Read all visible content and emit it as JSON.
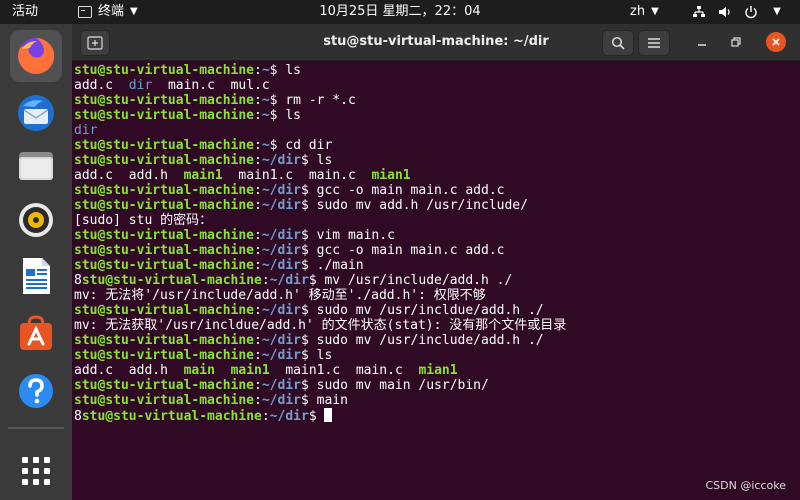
{
  "topbar": {
    "activities": "活动",
    "app_name": "终端",
    "clock": "10月25日 星期二，22：04",
    "lang": "zh"
  },
  "dock": {
    "items": [
      {
        "name": "firefox"
      },
      {
        "name": "thunderbird"
      },
      {
        "name": "files"
      },
      {
        "name": "rhythmbox"
      },
      {
        "name": "writer"
      },
      {
        "name": "software"
      },
      {
        "name": "help"
      },
      {
        "name": "show-apps"
      }
    ]
  },
  "window": {
    "title": "stu@stu-virtual-machine: ~/dir"
  },
  "terminal": {
    "user": "stu@stu-virtual-machine",
    "lines": [
      {
        "type": "prompt",
        "pre": "",
        "path": "~",
        "cmd": "ls"
      },
      {
        "type": "ls",
        "items": [
          {
            "t": "add.c",
            "c": "plain"
          },
          {
            "t": "dir",
            "c": "dir"
          },
          {
            "t": "main.c",
            "c": "plain"
          },
          {
            "t": "mul.c",
            "c": "plain"
          }
        ]
      },
      {
        "type": "prompt",
        "pre": "",
        "path": "~",
        "cmd": "rm -r *.c"
      },
      {
        "type": "prompt",
        "pre": "",
        "path": "~",
        "cmd": "ls"
      },
      {
        "type": "ls",
        "items": [
          {
            "t": "dir",
            "c": "dir"
          }
        ]
      },
      {
        "type": "prompt",
        "pre": "",
        "path": "~",
        "cmd": "cd dir"
      },
      {
        "type": "prompt",
        "pre": "",
        "path": "~/dir",
        "cmd": "ls"
      },
      {
        "type": "ls",
        "items": [
          {
            "t": "add.c",
            "c": "plain"
          },
          {
            "t": "add.h",
            "c": "plain"
          },
          {
            "t": "main1",
            "c": "exe"
          },
          {
            "t": "main1.c",
            "c": "plain"
          },
          {
            "t": "main.c",
            "c": "plain"
          },
          {
            "t": "mian1",
            "c": "exe"
          }
        ]
      },
      {
        "type": "prompt",
        "pre": "",
        "path": "~/dir",
        "cmd": "gcc -o main main.c add.c"
      },
      {
        "type": "prompt",
        "pre": "",
        "path": "~/dir",
        "cmd": "sudo mv add.h /usr/include/"
      },
      {
        "type": "text",
        "text": "[sudo] stu 的密码："
      },
      {
        "type": "prompt",
        "pre": "",
        "path": "~/dir",
        "cmd": "vim main.c"
      },
      {
        "type": "prompt",
        "pre": "",
        "path": "~/dir",
        "cmd": "gcc -o main main.c add.c"
      },
      {
        "type": "prompt",
        "pre": "",
        "path": "~/dir",
        "cmd": "./main"
      },
      {
        "type": "prompt",
        "pre": "8",
        "path": "~/dir",
        "cmd": "mv /usr/include/add.h ./"
      },
      {
        "type": "text",
        "text": "mv: 无法将'/usr/include/add.h' 移动至'./add.h': 权限不够"
      },
      {
        "type": "prompt",
        "pre": "",
        "path": "~/dir",
        "cmd": "sudo mv /usr/incldue/add.h ./"
      },
      {
        "type": "text",
        "text": "mv: 无法获取'/usr/incldue/add.h' 的文件状态(stat): 没有那个文件或目录"
      },
      {
        "type": "prompt",
        "pre": "",
        "path": "~/dir",
        "cmd": "sudo mv /usr/include/add.h ./"
      },
      {
        "type": "prompt",
        "pre": "",
        "path": "~/dir",
        "cmd": "ls"
      },
      {
        "type": "ls",
        "items": [
          {
            "t": "add.c",
            "c": "plain"
          },
          {
            "t": "add.h",
            "c": "plain"
          },
          {
            "t": "main",
            "c": "exe"
          },
          {
            "t": "main1",
            "c": "exe"
          },
          {
            "t": "main1.c",
            "c": "plain"
          },
          {
            "t": "main.c",
            "c": "plain"
          },
          {
            "t": "mian1",
            "c": "exe"
          }
        ]
      },
      {
        "type": "prompt",
        "pre": "",
        "path": "~/dir",
        "cmd": "sudo mv main /usr/bin/"
      },
      {
        "type": "prompt",
        "pre": "",
        "path": "~/dir",
        "cmd": "main"
      },
      {
        "type": "prompt",
        "pre": "8",
        "path": "~/dir",
        "cmd": "",
        "cursor": true
      }
    ]
  },
  "watermark": "CSDN @iccoke",
  "colors": {
    "terminal_bg": "#300a24",
    "prompt_user": "#8ae234",
    "prompt_path": "#729fcf",
    "close_button": "#e95420"
  }
}
